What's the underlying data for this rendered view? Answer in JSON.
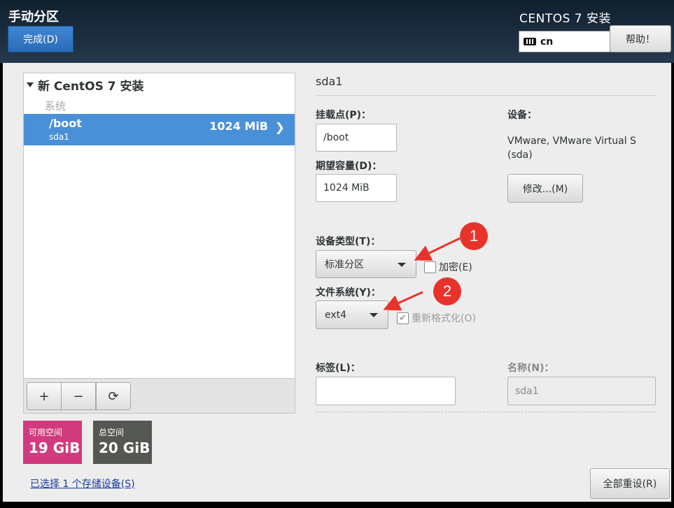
{
  "header": {
    "title": "手动分区",
    "done_label": "完成(D)",
    "product": "CENTOS 7 安装",
    "keyboard_layout": "cn",
    "help_label": "帮助！"
  },
  "tree": {
    "root_label": "新 CentOS 7 安装",
    "group_label": "系统",
    "items": [
      {
        "mount": "/boot",
        "device": "sda1",
        "size": "1024 MiB"
      }
    ]
  },
  "toolbar": {
    "add": "+",
    "remove": "−",
    "refresh": "⟳"
  },
  "space": {
    "free_label": "可用空间",
    "free_value": "19 GiB",
    "total_label": "总空间",
    "total_value": "20 GiB"
  },
  "storage_link": "已选择 1 个存储设备(S)",
  "details": {
    "title": "sda1",
    "mount_label": "挂载点(P)：",
    "mount_value": "/boot",
    "capacity_label": "期望容量(D)：",
    "capacity_value": "1024 MiB",
    "device_label": "设备：",
    "device_name_line1": "VMware, VMware Virtual S",
    "device_name_line2": "(sda)",
    "modify_label": "修改...(M)",
    "device_type_label": "设备类型(T)：",
    "device_type_value": "标准分区",
    "encrypt_label": "加密(E)",
    "fs_label": "文件系统(Y)：",
    "fs_value": "ext4",
    "reformat_label": "重新格式化(O)",
    "tag_label": "标签(L)：",
    "tag_value": "",
    "name_label": "名称(N)：",
    "name_value": "sda1"
  },
  "reset_label": "全部重设(R)",
  "annotations": {
    "marker1": "1",
    "marker2": "2"
  },
  "colors": {
    "accent": "#4a90d9",
    "free_space": "#d13b7d",
    "total_space": "#555753",
    "annotation": "#e8332c"
  }
}
